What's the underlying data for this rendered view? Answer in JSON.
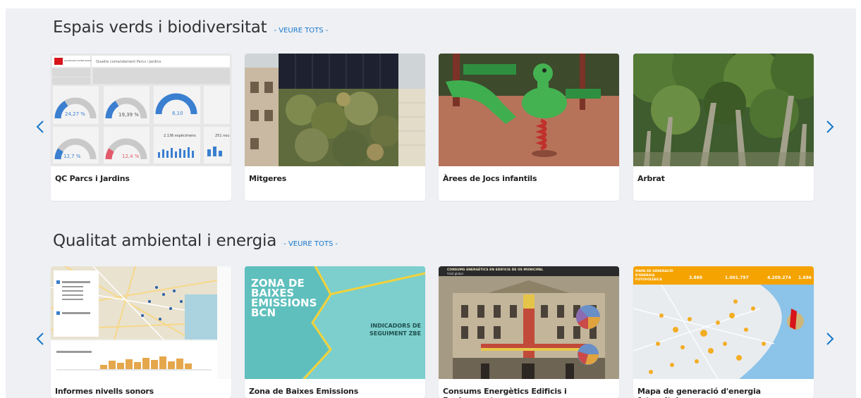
{
  "sections": [
    {
      "title": "Espais verds i biodiversitat",
      "see_all": "- VEURE TOTS -",
      "cards": [
        {
          "caption": "QC Parcs i Jardins",
          "thumb": {
            "header_title": "Quadre comandament Parcs i Jardins",
            "logo_text": "Ajuntament de Barcelona",
            "gauges": [
              "24,27 %",
              "19,39 %",
              "8,10",
              "12,7 %",
              "12,4 %"
            ],
            "stat": "2.136  espècimens",
            "stat2": "251 nou"
          }
        },
        {
          "caption": "Mitgeres"
        },
        {
          "caption": "Àrees de Jocs infantils"
        },
        {
          "caption": "Arbrat"
        }
      ]
    },
    {
      "title": "Qualitat ambiental i energia",
      "see_all": "- VEURE TOTS -",
      "cards": [
        {
          "caption": "Informes nivells sonors"
        },
        {
          "caption": "Zona de Baixes Emissions",
          "thumb": {
            "title_lines": [
              "ZONA DE",
              "BAIXES",
              "EMISSIONS",
              "BCN"
            ],
            "side_lines": [
              "INDICADORS DE",
              "SEGUIMENT ZBE"
            ]
          }
        },
        {
          "caption": "Consums Energètics Edificis i Equipaments",
          "thumb": {
            "header": "CONSUMS ENERGÈTICS EN EDIFICIS DE ÚS MUNICIPAL",
            "sub": "Visió global"
          }
        },
        {
          "caption": "Mapa de generació d'energia fotovoltaica",
          "thumb": {
            "header_lines": [
              "MAPA DE GENERACIÓ",
              "D'ENERGIA",
              "FOTOVOLTAICA"
            ],
            "stats": [
              "3.869",
              "1.001.797",
              "4.209.274",
              "1.696"
            ]
          }
        }
      ]
    }
  ],
  "icons": {
    "prev": "chevron-left-icon",
    "next": "chevron-right-icon"
  },
  "colors": {
    "accent": "#1877c9",
    "background": "#eef0f4"
  }
}
